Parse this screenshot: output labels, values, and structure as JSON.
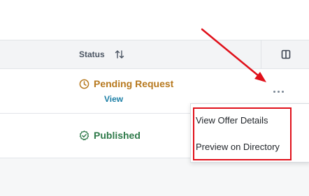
{
  "table": {
    "header": {
      "status_label": "Status",
      "sort_icon": "sort-arrows-icon",
      "columns_icon": "columns-toggle-icon"
    },
    "rows": [
      {
        "status": "Pending Request",
        "status_icon": "clock-icon",
        "status_color": "#b7791f",
        "link": "View"
      },
      {
        "status": "Published",
        "status_icon": "check-badge-icon",
        "status_color": "#2f7a4a"
      }
    ],
    "actions_icon": "more-horizontal-icon"
  },
  "menu": {
    "items": [
      {
        "label": "View Offer Details"
      },
      {
        "label": "Preview on Directory"
      }
    ]
  },
  "annotation": {
    "color": "#e0101a"
  }
}
